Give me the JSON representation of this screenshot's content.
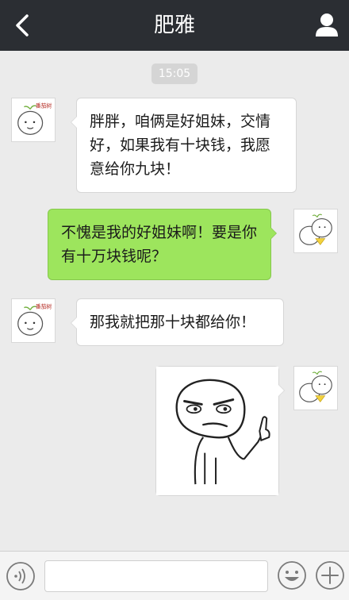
{
  "header": {
    "title": "肥雅",
    "back_icon": "chevron-left-icon",
    "profile_icon": "person-icon"
  },
  "chat": {
    "timestamp": "15:05",
    "messages": [
      {
        "side": "in",
        "type": "text",
        "text": "胖胖，咱俩是好姐妹，交情好，如果我有十块钱，我愿意给你九块！"
      },
      {
        "side": "out",
        "type": "text",
        "text": "不愧是我的好姐妹啊！要是你有十万块钱呢？"
      },
      {
        "side": "in",
        "type": "text",
        "text": "那我就把那十块都给你！"
      },
      {
        "side": "out",
        "type": "image",
        "image": "rage-face-middle-finger-sticker"
      }
    ],
    "avatar_friend_caption": "番茄树",
    "colors": {
      "outgoing_bubble": "#9de55d",
      "incoming_bubble": "#ffffff",
      "chat_background": "#ebebeb",
      "header": "#2b2e33"
    }
  },
  "input_bar": {
    "voice_icon": "voice-icon",
    "text_value": "",
    "emoji_icon": "emoji-icon",
    "more_icon": "plus-icon"
  }
}
